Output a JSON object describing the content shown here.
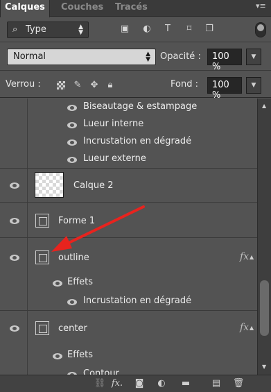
{
  "tabs": [
    {
      "label": "Calques",
      "active": true
    },
    {
      "label": "Couches",
      "active": false
    },
    {
      "label": "Tracés",
      "active": false
    }
  ],
  "filter": {
    "value": "Type",
    "icons": [
      "image-filter-icon",
      "adjustment-filter-icon",
      "type-filter-icon",
      "shape-filter-icon",
      "smart-object-filter-icon"
    ]
  },
  "blend": {
    "mode": "Normal",
    "opacity_label": "Opacité :",
    "opacity_value": "100 %"
  },
  "lock": {
    "label": "Verrou :",
    "fill_label": "Fond :",
    "fill_value": "100 %"
  },
  "effects_top": [
    "Biseautage & estampage",
    "Lueur interne",
    "Incrustation en dégradé",
    "Lueur externe"
  ],
  "layers": {
    "calque2": "Calque 2",
    "forme1": "Forme 1",
    "outline": "outline",
    "outline_effects_label": "Effets",
    "outline_effect1": "Incrustation en dégradé",
    "center": "center",
    "center_effects_label": "Effets",
    "center_effect1": "Contour"
  },
  "fx_label": "fx",
  "colors": {
    "accent_arrow": "#e8231e",
    "panel_bg": "#535353"
  },
  "bottom_icons": [
    "link-icon",
    "fx-icon",
    "mask-icon",
    "adjustment-icon",
    "group-folder-icon",
    "new-layer-icon",
    "trash-icon"
  ]
}
